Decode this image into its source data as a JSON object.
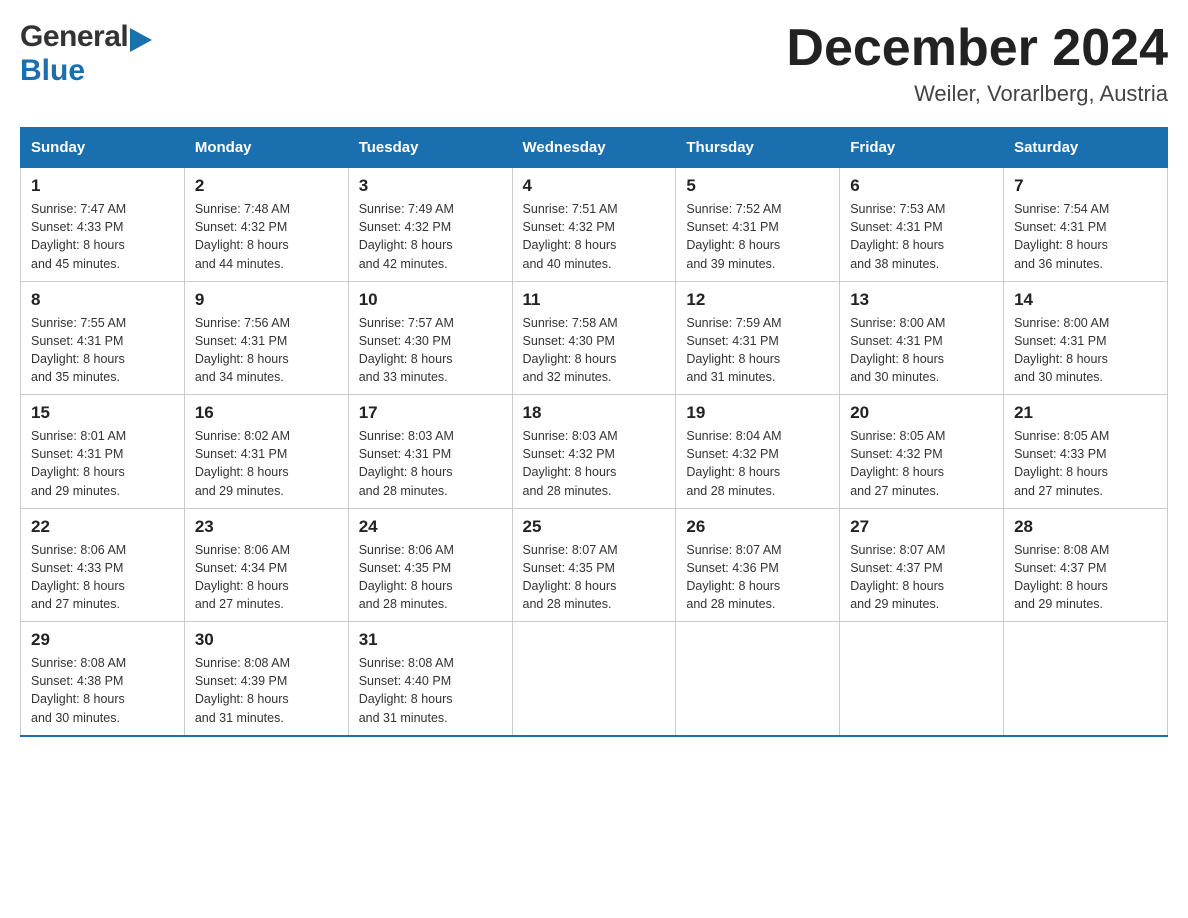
{
  "header": {
    "logo_general": "General",
    "logo_blue": "Blue",
    "month_title": "December 2024",
    "location": "Weiler, Vorarlberg, Austria"
  },
  "days_of_week": [
    "Sunday",
    "Monday",
    "Tuesday",
    "Wednesday",
    "Thursday",
    "Friday",
    "Saturday"
  ],
  "weeks": [
    [
      {
        "day": "1",
        "sunrise": "7:47 AM",
        "sunset": "4:33 PM",
        "daylight": "8 hours and 45 minutes."
      },
      {
        "day": "2",
        "sunrise": "7:48 AM",
        "sunset": "4:32 PM",
        "daylight": "8 hours and 44 minutes."
      },
      {
        "day": "3",
        "sunrise": "7:49 AM",
        "sunset": "4:32 PM",
        "daylight": "8 hours and 42 minutes."
      },
      {
        "day": "4",
        "sunrise": "7:51 AM",
        "sunset": "4:32 PM",
        "daylight": "8 hours and 40 minutes."
      },
      {
        "day": "5",
        "sunrise": "7:52 AM",
        "sunset": "4:31 PM",
        "daylight": "8 hours and 39 minutes."
      },
      {
        "day": "6",
        "sunrise": "7:53 AM",
        "sunset": "4:31 PM",
        "daylight": "8 hours and 38 minutes."
      },
      {
        "day": "7",
        "sunrise": "7:54 AM",
        "sunset": "4:31 PM",
        "daylight": "8 hours and 36 minutes."
      }
    ],
    [
      {
        "day": "8",
        "sunrise": "7:55 AM",
        "sunset": "4:31 PM",
        "daylight": "8 hours and 35 minutes."
      },
      {
        "day": "9",
        "sunrise": "7:56 AM",
        "sunset": "4:31 PM",
        "daylight": "8 hours and 34 minutes."
      },
      {
        "day": "10",
        "sunrise": "7:57 AM",
        "sunset": "4:30 PM",
        "daylight": "8 hours and 33 minutes."
      },
      {
        "day": "11",
        "sunrise": "7:58 AM",
        "sunset": "4:30 PM",
        "daylight": "8 hours and 32 minutes."
      },
      {
        "day": "12",
        "sunrise": "7:59 AM",
        "sunset": "4:31 PM",
        "daylight": "8 hours and 31 minutes."
      },
      {
        "day": "13",
        "sunrise": "8:00 AM",
        "sunset": "4:31 PM",
        "daylight": "8 hours and 30 minutes."
      },
      {
        "day": "14",
        "sunrise": "8:00 AM",
        "sunset": "4:31 PM",
        "daylight": "8 hours and 30 minutes."
      }
    ],
    [
      {
        "day": "15",
        "sunrise": "8:01 AM",
        "sunset": "4:31 PM",
        "daylight": "8 hours and 29 minutes."
      },
      {
        "day": "16",
        "sunrise": "8:02 AM",
        "sunset": "4:31 PM",
        "daylight": "8 hours and 29 minutes."
      },
      {
        "day": "17",
        "sunrise": "8:03 AM",
        "sunset": "4:31 PM",
        "daylight": "8 hours and 28 minutes."
      },
      {
        "day": "18",
        "sunrise": "8:03 AM",
        "sunset": "4:32 PM",
        "daylight": "8 hours and 28 minutes."
      },
      {
        "day": "19",
        "sunrise": "8:04 AM",
        "sunset": "4:32 PM",
        "daylight": "8 hours and 28 minutes."
      },
      {
        "day": "20",
        "sunrise": "8:05 AM",
        "sunset": "4:32 PM",
        "daylight": "8 hours and 27 minutes."
      },
      {
        "day": "21",
        "sunrise": "8:05 AM",
        "sunset": "4:33 PM",
        "daylight": "8 hours and 27 minutes."
      }
    ],
    [
      {
        "day": "22",
        "sunrise": "8:06 AM",
        "sunset": "4:33 PM",
        "daylight": "8 hours and 27 minutes."
      },
      {
        "day": "23",
        "sunrise": "8:06 AM",
        "sunset": "4:34 PM",
        "daylight": "8 hours and 27 minutes."
      },
      {
        "day": "24",
        "sunrise": "8:06 AM",
        "sunset": "4:35 PM",
        "daylight": "8 hours and 28 minutes."
      },
      {
        "day": "25",
        "sunrise": "8:07 AM",
        "sunset": "4:35 PM",
        "daylight": "8 hours and 28 minutes."
      },
      {
        "day": "26",
        "sunrise": "8:07 AM",
        "sunset": "4:36 PM",
        "daylight": "8 hours and 28 minutes."
      },
      {
        "day": "27",
        "sunrise": "8:07 AM",
        "sunset": "4:37 PM",
        "daylight": "8 hours and 29 minutes."
      },
      {
        "day": "28",
        "sunrise": "8:08 AM",
        "sunset": "4:37 PM",
        "daylight": "8 hours and 29 minutes."
      }
    ],
    [
      {
        "day": "29",
        "sunrise": "8:08 AM",
        "sunset": "4:38 PM",
        "daylight": "8 hours and 30 minutes."
      },
      {
        "day": "30",
        "sunrise": "8:08 AM",
        "sunset": "4:39 PM",
        "daylight": "8 hours and 31 minutes."
      },
      {
        "day": "31",
        "sunrise": "8:08 AM",
        "sunset": "4:40 PM",
        "daylight": "8 hours and 31 minutes."
      },
      null,
      null,
      null,
      null
    ]
  ],
  "labels": {
    "sunrise_prefix": "Sunrise: ",
    "sunset_prefix": "Sunset: ",
    "daylight_prefix": "Daylight: "
  }
}
